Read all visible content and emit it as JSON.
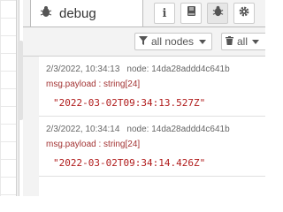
{
  "sidebar": {
    "tab": {
      "label": "debug",
      "icon": "bug-icon"
    },
    "tab_buttons": [
      {
        "icon": "info-icon",
        "glyph": "i"
      },
      {
        "icon": "book-icon"
      },
      {
        "icon": "bug-icon"
      },
      {
        "icon": "gear-icon"
      }
    ]
  },
  "toolbar": {
    "filter_label": "all nodes",
    "clear_label": "all"
  },
  "messages": [
    {
      "timestamp": "2/3/2022, 10:34:13",
      "node": "node: 14da28addd4c641b",
      "property": "msg.payload : string[24]",
      "value": "\"2022-03-02T09:34:13.527Z\""
    },
    {
      "timestamp": "2/3/2022, 10:34:14",
      "node": "node: 14da28addd4c641b",
      "property": "msg.payload : string[24]",
      "value": "\"2022-03-02T09:34:14.426Z\""
    }
  ]
}
